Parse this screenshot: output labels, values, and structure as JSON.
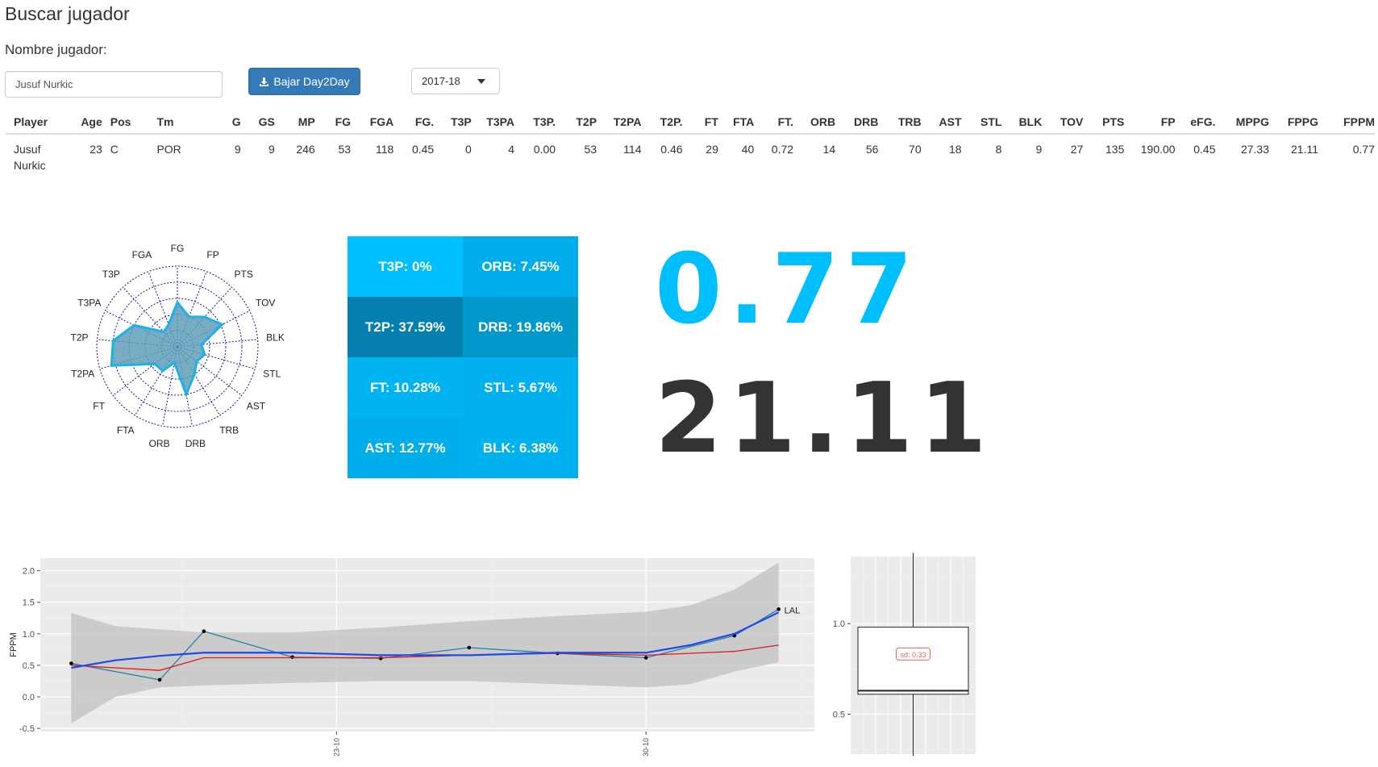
{
  "page": {
    "title": "Buscar jugador",
    "name_label": "Nombre jugador:"
  },
  "search": {
    "value": "Jusuf Nurkic"
  },
  "download": {
    "label": "Bajar Day2Day",
    "icon": "download-icon"
  },
  "season": {
    "selected": "2017-18"
  },
  "table": {
    "headers": [
      "Player",
      "Age",
      "Pos",
      "Tm",
      "G",
      "GS",
      "MP",
      "FG",
      "FGA",
      "FG.",
      "T3P",
      "T3PA",
      "T3P.",
      "T2P",
      "T2PA",
      "T2P.",
      "FT",
      "FTA",
      "FT.",
      "ORB",
      "DRB",
      "TRB",
      "AST",
      "STL",
      "BLK",
      "TOV",
      "PTS",
      "FP",
      "eFG.",
      "MPPG",
      "FPPG",
      "FPPM"
    ],
    "row": [
      "Jusuf Nurkic",
      "23",
      "C",
      "POR",
      "9",
      "9",
      "246",
      "53",
      "118",
      "0.45",
      "0",
      "4",
      "0.00",
      "53",
      "114",
      "0.46",
      "29",
      "40",
      "0.72",
      "14",
      "56",
      "70",
      "18",
      "8",
      "9",
      "27",
      "135",
      "190.00",
      "0.45",
      "27.33",
      "21.11",
      "0.77"
    ]
  },
  "radar": {
    "axes": [
      "FG",
      "FP",
      "PTS",
      "TOV",
      "BLK",
      "STL",
      "AST",
      "TRB",
      "DRB",
      "ORB",
      "FTA",
      "FT",
      "T2PA",
      "T2P",
      "T3PA",
      "T3P",
      "FGA"
    ],
    "values": [
      0.55,
      0.4,
      0.5,
      0.62,
      0.3,
      0.35,
      0.3,
      0.4,
      0.6,
      0.2,
      0.35,
      0.35,
      0.85,
      0.8,
      0.6,
      0.25,
      0.3
    ],
    "fill_color": "#5f9eb8",
    "line_color": "#1eb0e6",
    "grid_color": "#0d1a8c"
  },
  "tiles": [
    {
      "label": "T3P: 0%",
      "color": "#00bfff"
    },
    {
      "label": "ORB: 7.45%",
      "color": "#00adea"
    },
    {
      "label": "T2P: 37.59%",
      "color": "#0480b0"
    },
    {
      "label": "DRB: 19.86%",
      "color": "#0298cc"
    },
    {
      "label": "FT: 10.28%",
      "color": "#00b4f2"
    },
    {
      "label": "STL: 5.67%",
      "color": "#00b0ef"
    },
    {
      "label": "AST: 12.77%",
      "color": "#00aeeb"
    },
    {
      "label": "BLK: 6.38%",
      "color": "#00b1ef"
    }
  ],
  "big_numbers": {
    "fppm": "0.77",
    "fppg": "21.11",
    "fppm_color": "#00bfff",
    "fppg_color": "#333333"
  },
  "chart_data": [
    {
      "type": "line",
      "ylabel": "FPPM",
      "xlabel": "",
      "ylim": [
        -0.55,
        2.2
      ],
      "yticks": [
        "-0.5",
        "0.0",
        "0.5",
        "1.0",
        "1.5",
        "2.0"
      ],
      "xticks": [
        {
          "label": "23-10",
          "x": 23
        },
        {
          "label": "30-10",
          "x": 30
        }
      ],
      "xlim": [
        16.3,
        33.9
      ],
      "grid": true,
      "annotation": "LAL",
      "series": [
        {
          "x": [
            17,
            19,
            20,
            22,
            24,
            26,
            28,
            30,
            32,
            33
          ],
          "values": [
            0.53,
            0.27,
            1.04,
            0.63,
            0.61,
            0.78,
            0.69,
            0.62,
            0.97,
            1.39
          ],
          "color": "#2b7fa8",
          "points": true
        },
        {
          "x": [
            17,
            19,
            20,
            22,
            24,
            26,
            28,
            30,
            32,
            33
          ],
          "values": [
            0.5,
            0.42,
            0.62,
            0.62,
            0.62,
            0.66,
            0.69,
            0.66,
            0.72,
            0.82
          ],
          "color": "#dd1a1a"
        },
        {
          "x": [
            17,
            18,
            19,
            20,
            22,
            24,
            26,
            28,
            30,
            31,
            32,
            33
          ],
          "values": [
            0.46,
            0.58,
            0.65,
            0.7,
            0.7,
            0.66,
            0.66,
            0.7,
            0.7,
            0.82,
            1.0,
            1.34
          ],
          "color": "#2049e6"
        }
      ],
      "band_upper": [
        1.33,
        1.12,
        1.07,
        1.02,
        1.02,
        1.1,
        1.2,
        1.28,
        1.35,
        1.45,
        1.7,
        2.13
      ],
      "band_lower": [
        -0.42,
        0.0,
        0.15,
        0.18,
        0.22,
        0.25,
        0.25,
        0.2,
        0.15,
        0.2,
        0.4,
        0.55
      ],
      "band_x": [
        17,
        18,
        19,
        20,
        22,
        24,
        26,
        28,
        30,
        31,
        32,
        33
      ]
    },
    {
      "type": "box",
      "ylim": [
        0.28,
        1.37
      ],
      "yticks": [
        "0.5",
        "1.0"
      ],
      "min": 0.27,
      "q1": 0.61,
      "median": 0.63,
      "q3": 0.98,
      "max": 1.39,
      "annotation": "sd: 0.33",
      "grid": true
    }
  ]
}
